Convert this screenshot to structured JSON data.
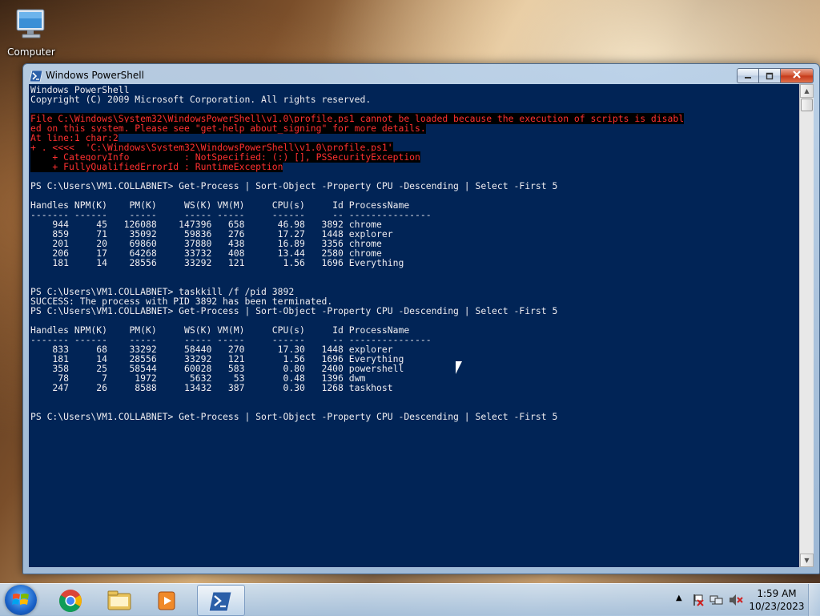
{
  "desktop": {
    "icons": [
      {
        "label": "Computer",
        "icon": "computer-icon"
      }
    ]
  },
  "window": {
    "title": "Windows PowerShell",
    "icon": "powershell-icon",
    "controls": {
      "minimize": "minimize-icon",
      "maximize": "maximize-icon",
      "close": "close-icon"
    }
  },
  "console": {
    "background": "#012456",
    "foreground": "#eeedf0",
    "error_color": "#ff3030",
    "header_lines": [
      "Windows PowerShell",
      "Copyright (C) 2009 Microsoft Corporation. All rights reserved."
    ],
    "error_lines": [
      "File C:\\Windows\\System32\\WindowsPowerShell\\v1.0\\profile.ps1 cannot be loaded because the execution of scripts is disabl",
      "ed on this system. Please see \"get-help about_signing\" for more details.",
      "At line:1 char:2",
      "+ . <<<<  'C:\\Windows\\System32\\WindowsPowerShell\\v1.0\\profile.ps1'",
      "    + CategoryInfo          : NotSpecified: (:) [], PSSecurityException",
      "    + FullyQualifiedErrorId : RuntimeException"
    ],
    "prompt": "PS C:\\Users\\VM1.COLLABNET>",
    "commands": [
      "Get-Process | Sort-Object -Property CPU -Descending | Select -First 5",
      "taskkill /f /pid 3892",
      "Get-Process | Sort-Object -Property CPU -Descending | Select -First 5",
      "Get-Process | Sort-Object -Property CPU -Descending | Select -First 5"
    ],
    "columns": [
      "Handles",
      "NPM(K)",
      "PM(K)",
      "WS(K)",
      "VM(M)",
      "CPU(s)",
      "Id",
      "ProcessName"
    ],
    "table1": [
      [
        "944",
        "45",
        "126088",
        "147396",
        "658",
        "46.98",
        "3892",
        "chrome"
      ],
      [
        "859",
        "71",
        "35092",
        "59836",
        "276",
        "17.27",
        "1448",
        "explorer"
      ],
      [
        "201",
        "20",
        "69860",
        "37880",
        "438",
        "16.89",
        "3356",
        "chrome"
      ],
      [
        "206",
        "17",
        "64268",
        "33732",
        "408",
        "13.44",
        "2580",
        "chrome"
      ],
      [
        "181",
        "14",
        "28556",
        "33292",
        "121",
        "1.56",
        "1696",
        "Everything"
      ]
    ],
    "success_message": "SUCCESS: The process with PID 3892 has been terminated.",
    "table2": [
      [
        "833",
        "68",
        "33292",
        "58440",
        "270",
        "17.30",
        "1448",
        "explorer"
      ],
      [
        "181",
        "14",
        "28556",
        "33292",
        "121",
        "1.56",
        "1696",
        "Everything"
      ],
      [
        "358",
        "25",
        "58544",
        "60028",
        "583",
        "0.80",
        "2400",
        "powershell"
      ],
      [
        "78",
        "7",
        "1972",
        "5632",
        "53",
        "0.48",
        "1396",
        "dwm"
      ],
      [
        "247",
        "26",
        "8588",
        "13432",
        "387",
        "0.30",
        "1268",
        "taskhost"
      ]
    ]
  },
  "taskbar": {
    "start_icon": "windows-start-icon",
    "pinned": [
      {
        "name": "chrome",
        "icon": "chrome-icon"
      },
      {
        "name": "explorer",
        "icon": "folder-icon"
      },
      {
        "name": "media",
        "icon": "media-player-icon"
      },
      {
        "name": "powershell",
        "icon": "powershell-icon",
        "active": true
      }
    ],
    "tray_icons": [
      "show-hidden-icons-chevron",
      "action-center-flag-icon",
      "network-icon",
      "volume-muted-icon"
    ],
    "clock": {
      "time": "1:59 AM",
      "date": "10/23/2023"
    }
  }
}
